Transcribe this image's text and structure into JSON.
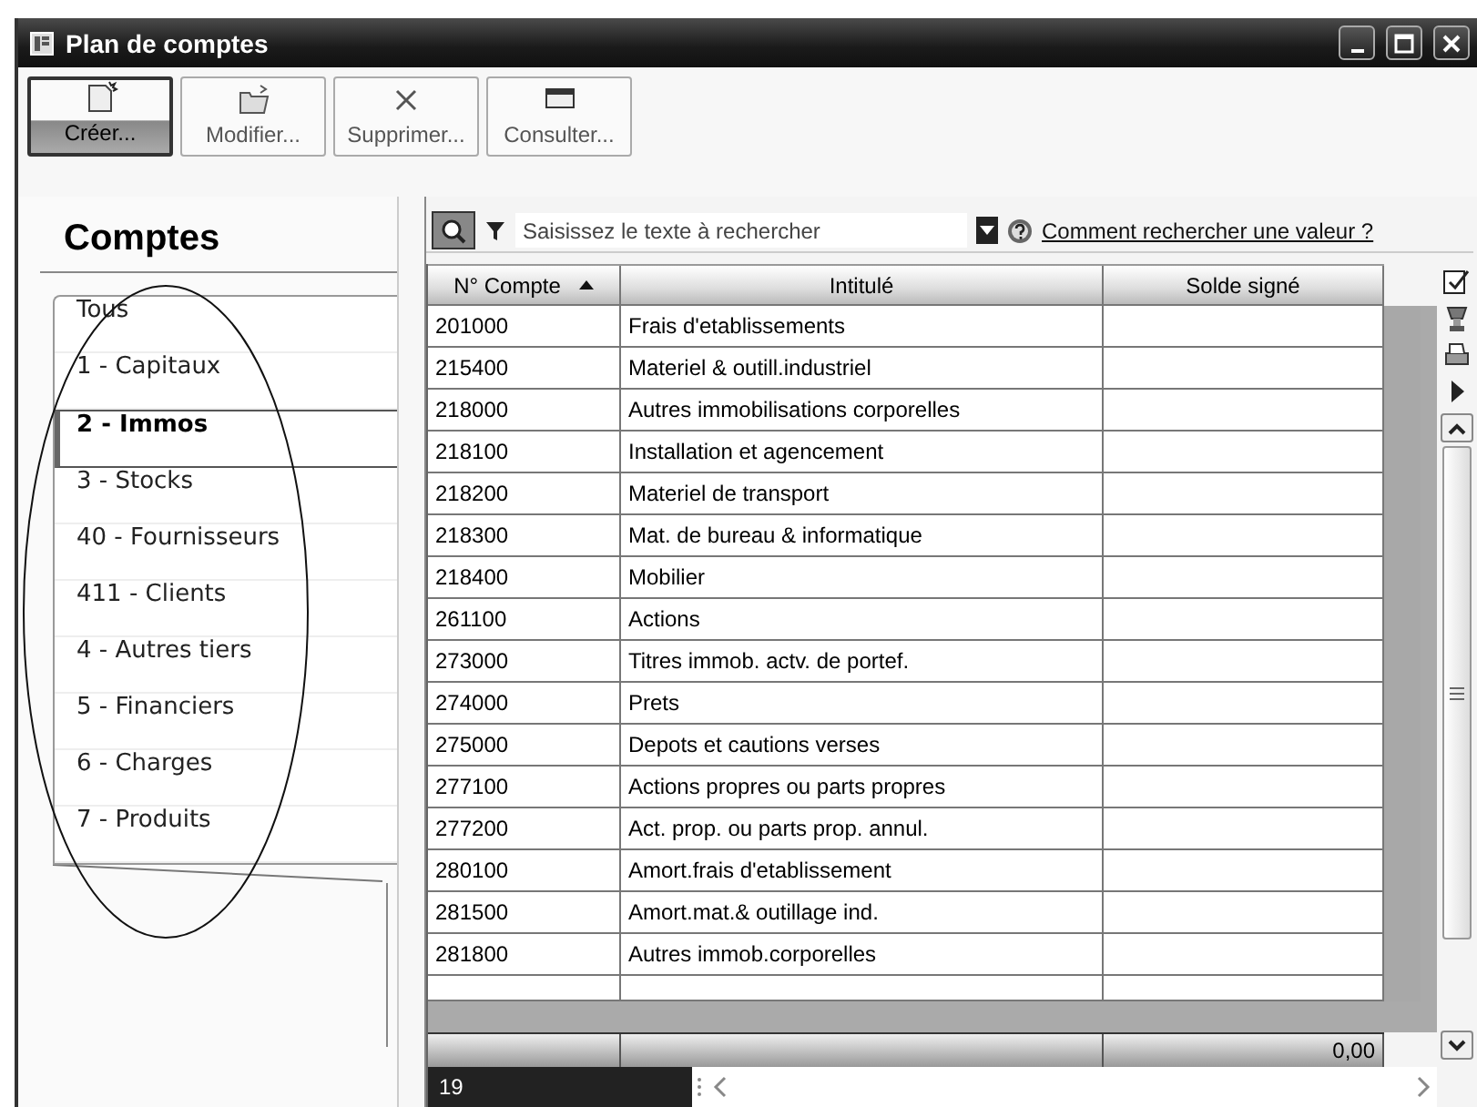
{
  "window": {
    "title": "Plan de comptes"
  },
  "toolbar": [
    {
      "label": "Créer...",
      "kind": "new",
      "selected": true
    },
    {
      "label": "Modifier...",
      "kind": "open",
      "selected": false
    },
    {
      "label": "Supprimer...",
      "kind": "delete",
      "selected": false
    },
    {
      "label": "Consulter...",
      "kind": "view",
      "selected": false
    }
  ],
  "sidebar": {
    "title": "Comptes",
    "items": [
      {
        "label": "Tous",
        "selected": false
      },
      {
        "label": "1 - Capitaux",
        "selected": false
      },
      {
        "label": "2 - Immos",
        "selected": true
      },
      {
        "label": "3 - Stocks",
        "selected": false
      },
      {
        "label": "40 - Fournisseurs",
        "selected": false
      },
      {
        "label": "411 - Clients",
        "selected": false
      },
      {
        "label": "4 - Autres tiers",
        "selected": false
      },
      {
        "label": "5 - Financiers",
        "selected": false
      },
      {
        "label": "6 - Charges",
        "selected": false
      },
      {
        "label": "7 - Produits",
        "selected": false
      }
    ]
  },
  "annotation": {
    "kind": "ellipse"
  },
  "search": {
    "placeholder": "Saisissez le texte à rechercher",
    "help_link": "Comment rechercher une valeur ?"
  },
  "table": {
    "columns": [
      {
        "label": "N° Compte",
        "sorted": true
      },
      {
        "label": "Intitulé",
        "sorted": false
      },
      {
        "label": "Solde signé",
        "sorted": false
      }
    ],
    "rows": [
      {
        "number": "201000",
        "title": "Frais d'etablissements"
      },
      {
        "number": "215400",
        "title": "Materiel & outill.industriel"
      },
      {
        "number": "218000",
        "title": "Autres immobilisations corporelles"
      },
      {
        "number": "218100",
        "title": "Installation et agencement"
      },
      {
        "number": "218200",
        "title": "Materiel de transport"
      },
      {
        "number": "218300",
        "title": "Mat. de bureau & informatique"
      },
      {
        "number": "218400",
        "title": "Mobilier"
      },
      {
        "number": "261100",
        "title": "Actions"
      },
      {
        "number": "273000",
        "title": "Titres immob. actv. de portef."
      },
      {
        "number": "274000",
        "title": "Prets"
      },
      {
        "number": "275000",
        "title": "Depots et cautions verses"
      },
      {
        "number": "277100",
        "title": "Actions propres ou parts propres"
      },
      {
        "number": "277200",
        "title": "Act. prop. ou parts prop. annul."
      },
      {
        "number": "280100",
        "title": "Amort.frais d'etablissement"
      },
      {
        "number": "281500",
        "title": "Amort.mat.& outillage ind."
      },
      {
        "number": "281800",
        "title": "Autres immob.corporelles"
      }
    ],
    "total": "0,00",
    "count": "19"
  }
}
